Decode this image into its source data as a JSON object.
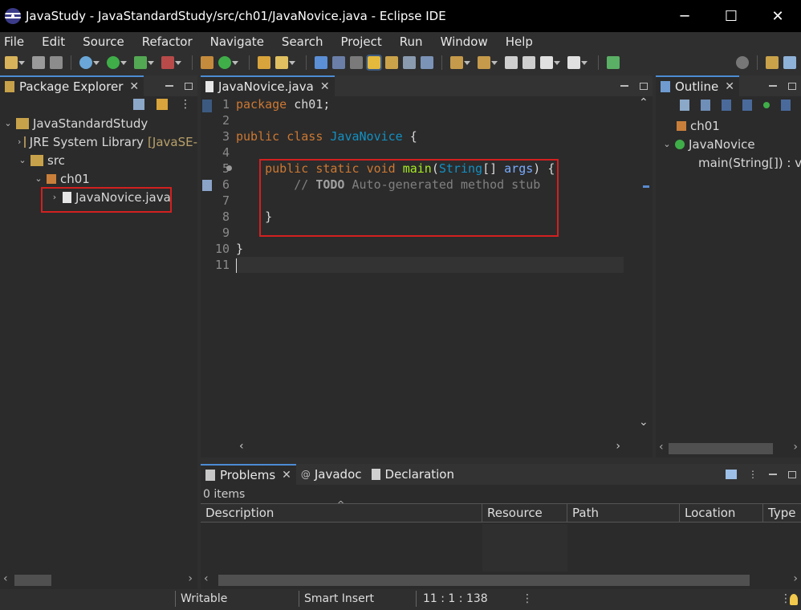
{
  "window": {
    "title": "JavaStudy - JavaStandardStudy/src/ch01/JavaNovice.java - Eclipse IDE",
    "minimize": "─",
    "maximize": "☐",
    "close": "✕"
  },
  "menu": [
    "File",
    "Edit",
    "Source",
    "Refactor",
    "Navigate",
    "Search",
    "Project",
    "Run",
    "Window",
    "Help"
  ],
  "package_explorer": {
    "tab": "Package Explorer",
    "tree": [
      {
        "label": "JavaStandardStudy",
        "expanded": true
      },
      {
        "label": "JRE System Library",
        "detail": "[JavaSE-"
      },
      {
        "label": "src",
        "expanded": true
      },
      {
        "label": "ch01",
        "expanded": true
      },
      {
        "label": "JavaNovice.java",
        "selected": true
      }
    ]
  },
  "editor": {
    "tab": "JavaNovice.java",
    "line_numbers": [
      "1",
      "2",
      "3",
      "4",
      "5",
      "6",
      "7",
      "8",
      "9",
      "10",
      "11"
    ],
    "code": {
      "l1_kw": "package",
      "l1_rest": " ch01;",
      "l3_kw1": "public",
      "l3_kw2": "class",
      "l3_name": "JavaNovice",
      "l3_rest": " {",
      "l5_kw1": "public",
      "l5_kw2": "static",
      "l5_kw3": "void",
      "l5_fn": "main",
      "l5_type": "String",
      "l5_arr": "[] ",
      "l5_param": "args",
      "l5_rest": ") {",
      "l6_cm": "// ",
      "l6_todo": "TODO",
      "l6_text": " Auto-generated method stub",
      "l8": "}",
      "l10": "}"
    }
  },
  "outline": {
    "tab": "Outline",
    "items": [
      "ch01",
      "JavaNovice",
      "main(String[]) : v"
    ]
  },
  "bottom": {
    "tabs": [
      "Problems",
      "Javadoc",
      "Declaration"
    ],
    "items_count": "0 items",
    "columns": [
      "Description",
      "Resource",
      "Path",
      "Location",
      "Type"
    ]
  },
  "status": {
    "writable": "Writable",
    "insert_mode": "Smart Insert",
    "position": "11 : 1 : 138"
  }
}
